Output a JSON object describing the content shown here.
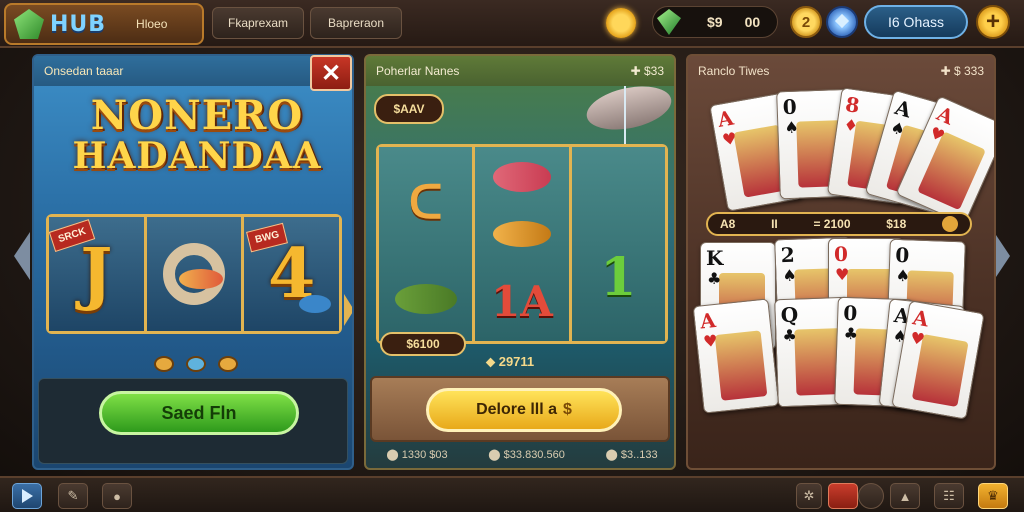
{
  "top_bar": {
    "logo_text": "HUB",
    "logo_sub": "Hloeo",
    "nav": [
      "Fkaprexam",
      "Bapreraon"
    ],
    "currency_amount_a": "$9",
    "currency_amount_b": "00",
    "coin_symbol": "2",
    "profile_label": "I6 Ohass",
    "plus_symbol": "+"
  },
  "panels": [
    {
      "header_title": "Onsedan taaar",
      "close_symbol": "✕",
      "title_line1": "NONERO",
      "title_line2": "HADANDAA",
      "reel_symbols": [
        "J",
        "",
        "4"
      ],
      "tag_a": "SRCK",
      "tag_b": "BWG",
      "button_label": "Saed Fln"
    },
    {
      "header_title": "Poherlar Nanes",
      "header_right": "✚ $33",
      "tag": "$AAV",
      "reel_symbols": [
        "",
        "1A",
        "1"
      ],
      "pill_label": "$6100",
      "sub_label": "⬥ 29711",
      "button_label": "Delore lll a",
      "button_icon": "$",
      "stats": [
        "⬤ 1330 $03",
        "⬤ $33.830.560",
        "⬤ $3..133"
      ]
    },
    {
      "header_title": "Ranclo Tiwes",
      "header_right": "✚ $ 333",
      "bar_left": "A8",
      "bar_mid_a": "II",
      "bar_mid_b": "= 2100",
      "bar_right": "$18",
      "cards_top": [
        {
          "rank": "A",
          "suit": "♥",
          "color": "red"
        },
        {
          "rank": "0",
          "suit": "♠",
          "color": "blk"
        },
        {
          "rank": "8",
          "suit": "♦",
          "color": "red"
        },
        {
          "rank": "A",
          "suit": "♠",
          "color": "blk"
        },
        {
          "rank": "A",
          "suit": "♥",
          "color": "red"
        }
      ],
      "cards_bottom_row1": [
        {
          "rank": "K",
          "suit": "♣",
          "color": "blk"
        },
        {
          "rank": "2",
          "suit": "♠",
          "color": "blk"
        },
        {
          "rank": "0",
          "suit": "♥",
          "color": "red"
        },
        {
          "rank": "0",
          "suit": "♠",
          "color": "blk"
        }
      ],
      "cards_bottom_row2": [
        {
          "rank": "A",
          "suit": "♥",
          "color": "red"
        },
        {
          "rank": "Q",
          "suit": "♣",
          "color": "blk"
        },
        {
          "rank": "0",
          "suit": "♣",
          "color": "blk"
        },
        {
          "rank": "A",
          "suit": "♠",
          "color": "blk"
        },
        {
          "rank": "A",
          "suit": "♥",
          "color": "red"
        }
      ]
    }
  ],
  "bottom_bar": {
    "icons": [
      "play-icon",
      "chat-icon",
      "settings-icon",
      "gear-icon",
      "alert-icon",
      "circle-icon",
      "profile-icon",
      "menu-icon",
      "trophy-icon"
    ]
  },
  "colors": {
    "accent_gold": "#e2b451",
    "green_button": "#2e9a1c",
    "yellow_button": "#e8a91a",
    "close_red": "#c73626"
  }
}
